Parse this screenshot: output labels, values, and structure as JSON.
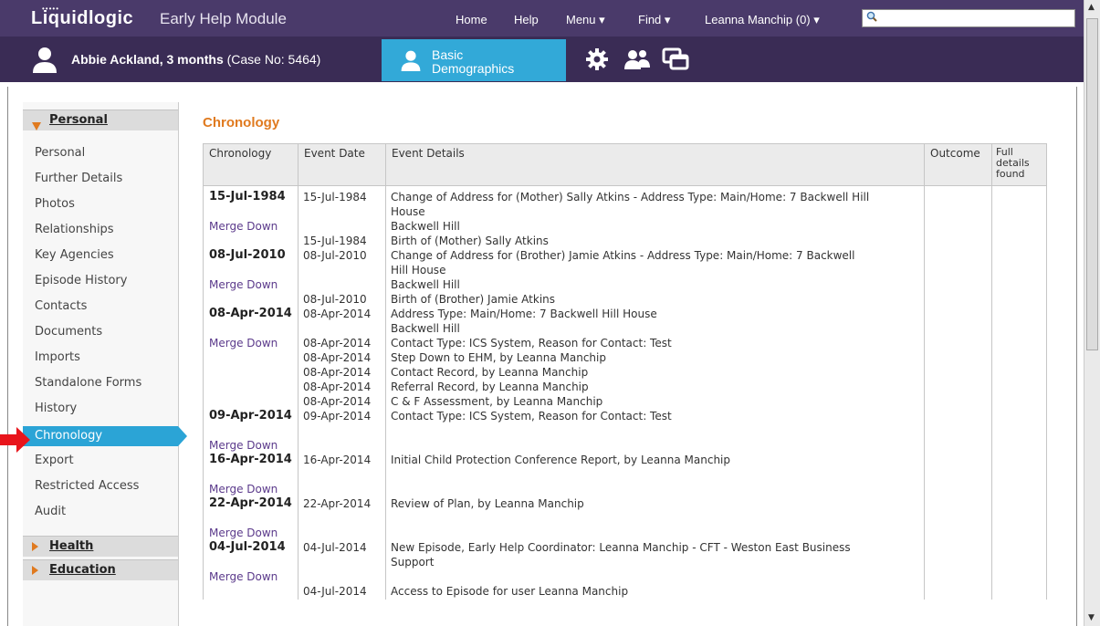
{
  "header": {
    "logo_text": "Liquidlogic",
    "module_title": "Early Help Module",
    "nav": [
      {
        "label": "Home"
      },
      {
        "label": "Help"
      },
      {
        "label": "Menu ▾"
      },
      {
        "label": "Find ▾"
      },
      {
        "label": "Leanna Manchip (0) ▾"
      }
    ],
    "search_value": ""
  },
  "case_bar": {
    "case_name": "Abbie Ackland, 3 months",
    "case_number": "(Case No: 5464)",
    "active_tab_line1": "Basic",
    "active_tab_line2": "Demographics",
    "icons": [
      "gear-icon",
      "people-icon",
      "windows-icon"
    ]
  },
  "sidebar": {
    "groups": [
      {
        "label": "Personal",
        "expanded": true
      },
      {
        "label": "Health",
        "expanded": false
      },
      {
        "label": "Education",
        "expanded": false
      }
    ],
    "items": [
      {
        "label": "Personal"
      },
      {
        "label": "Further Details"
      },
      {
        "label": "Photos"
      },
      {
        "label": "Relationships"
      },
      {
        "label": "Key Agencies"
      },
      {
        "label": "Episode History"
      },
      {
        "label": "Contacts"
      },
      {
        "label": "Documents"
      },
      {
        "label": "Imports"
      },
      {
        "label": "Standalone Forms"
      },
      {
        "label": "History"
      },
      {
        "label": "Chronology"
      },
      {
        "label": "Export"
      },
      {
        "label": "Restricted Access"
      },
      {
        "label": "Audit"
      }
    ],
    "active_item": "Chronology"
  },
  "main": {
    "heading": "Chronology",
    "columns": [
      "Chronology",
      "Event Date",
      "Event Details",
      "Outcome",
      "Full details found"
    ],
    "rows": [
      {
        "chronology": [
          "15-Jul-1984",
          "",
          "Merge Down"
        ],
        "dates": [
          "15-Jul-1984",
          "",
          "",
          "15-Jul-1984"
        ],
        "details": [
          "Change of Address for (Mother) Sally Atkins - Address Type: Main/Home: 7 Backwell Hill",
          "House",
          "Backwell Hill",
          "Birth of (Mother) Sally Atkins"
        ]
      },
      {
        "chronology": [
          "08-Jul-2010",
          "",
          "Merge Down"
        ],
        "dates": [
          "08-Jul-2010",
          "",
          "",
          "08-Jul-2010"
        ],
        "details": [
          "Change of Address for (Brother) Jamie Atkins - Address Type: Main/Home: 7 Backwell",
          "Hill House",
          "Backwell Hill",
          "Birth of (Brother) Jamie Atkins"
        ]
      },
      {
        "chronology": [
          "08-Apr-2014",
          "",
          "Merge Down"
        ],
        "dates": [
          "08-Apr-2014",
          "",
          "08-Apr-2014",
          "08-Apr-2014",
          "08-Apr-2014",
          "08-Apr-2014",
          "08-Apr-2014"
        ],
        "details": [
          "Address Type: Main/Home: 7 Backwell Hill House",
          "Backwell Hill",
          "Contact Type: ICS System, Reason for Contact: Test",
          "Step Down to EHM, by Leanna Manchip",
          "Contact Record, by Leanna Manchip",
          "Referral Record, by Leanna Manchip",
          "C & F Assessment, by Leanna Manchip"
        ]
      },
      {
        "chronology": [
          "09-Apr-2014",
          "",
          "Merge Down"
        ],
        "dates": [
          "09-Apr-2014"
        ],
        "details": [
          "Contact Type: ICS System, Reason for Contact: Test"
        ]
      },
      {
        "chronology": [
          "16-Apr-2014",
          "",
          "Merge Down"
        ],
        "dates": [
          "16-Apr-2014"
        ],
        "details": [
          "Initial Child Protection Conference Report, by Leanna Manchip"
        ]
      },
      {
        "chronology": [
          "22-Apr-2014",
          "",
          "Merge Down"
        ],
        "dates": [
          "22-Apr-2014"
        ],
        "details": [
          "Review of Plan, by Leanna Manchip"
        ]
      },
      {
        "chronology": [
          "04-Jul-2014",
          "",
          "Merge Down"
        ],
        "dates": [
          "04-Jul-2014",
          "",
          "",
          "04-Jul-2014"
        ],
        "details": [
          "New Episode, Early Help Coordinator: Leanna Manchip - CFT - Weston East Business",
          "Support",
          "",
          "Access to Episode for user Leanna Manchip"
        ]
      }
    ]
  },
  "colors": {
    "topbar": "#4a3a6a",
    "casebar": "#3a2c55",
    "accent_blue": "#2ba4d6",
    "heading_orange": "#e07a1f",
    "merge_link": "#5b3a8b",
    "pointer_red": "#e8141b"
  }
}
